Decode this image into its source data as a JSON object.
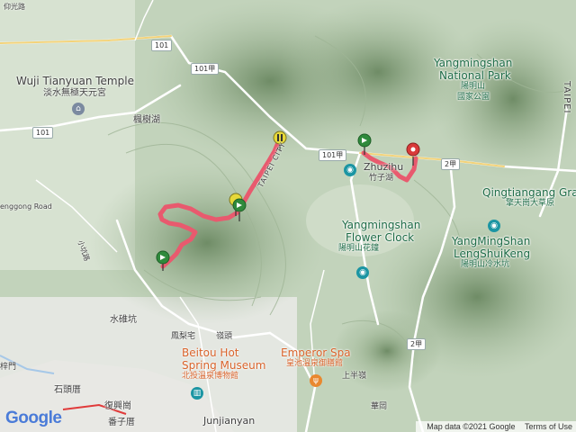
{
  "map": {
    "places": {
      "wuji_en": "Wuji Tianyuan Temple",
      "wuji_zh": "淡水無極天元宮",
      "fengshuhu": "楓樹湖",
      "yms_park_en1": "Yangmingshan",
      "yms_park_en2": "National Park",
      "yms_park_zh1": "陽明山",
      "yms_park_zh2": "國家公園",
      "taipei_right": "TAIPEI",
      "zhuzihu_en": "Zhuzihu",
      "zhuzihu_zh": "竹子湖",
      "qtg_en": "Qingtiangang Gra",
      "qtg_zh": "擎天崗大草原",
      "flower_en1": "Yangmingshan",
      "flower_en2": "Flower Clock",
      "flower_zh": "陽明山花鐘",
      "lsk_en1": "YangMingShan",
      "lsk_en2": "LengShuiKeng",
      "lsk_zh": "陽明山冷水坑",
      "taipei_city": "TAIPEI CITY",
      "gengong": "enggong Road",
      "shuiweikeng": "水碓坑",
      "fenglizhai": "鳳梨宅",
      "dingtou": "嶺頭",
      "beitou_en1": "Beitou Hot",
      "beitou_en2": "Spring Museum",
      "beitou_zh": "北投溫泉博物館",
      "emperor_en": "Emperor Spa",
      "emperor_zh": "皇池溫泉御膳館",
      "shangbanling": "上半嶺",
      "shitoucuo": "石頭厝",
      "fuxinggang": "復興崗",
      "fanzicuo": "番子厝",
      "huagang": "華岡",
      "junjianyan": "Junjianyan",
      "tianmu_top": "仰光路",
      "saimen": "梓門",
      "xiaohuanshan": "小坑路"
    },
    "roads": {
      "r101_top": "101",
      "r101a_top": "101甲",
      "r101_left": "101",
      "r101a_mid": "101甲",
      "r2a": "2甲",
      "r2a_low": "2甲"
    },
    "attribution": {
      "logo": "Google",
      "mapdata": "Map data ©2021 Google",
      "terms": "Terms of Use"
    },
    "colors": {
      "route": "#e85a6e",
      "trail_marker": "#2f8a3c",
      "end_marker": "#d93a3a",
      "middle_marker": "#e6d83a",
      "poi_teal": "#1b95a3"
    },
    "icons": [
      "trail-start-icon",
      "trail-marker-icon",
      "end-marker-icon",
      "pause-marker-icon",
      "temple-icon",
      "camera-icon",
      "restaurant-icon",
      "museum-icon"
    ]
  }
}
